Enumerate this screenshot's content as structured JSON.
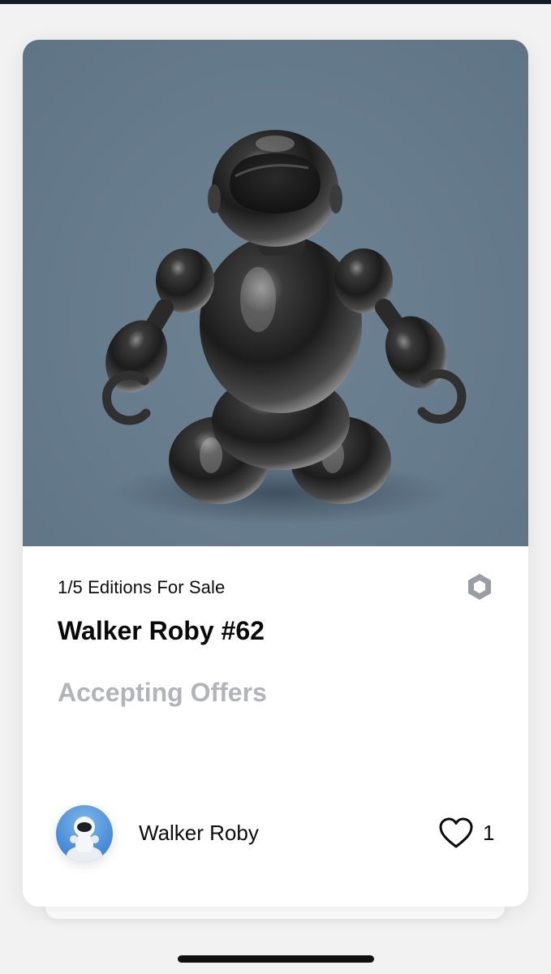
{
  "card": {
    "artwork_alt": "Chrome robot figure",
    "editions_label": "1/5 Editions For Sale",
    "title": "Walker Roby #62",
    "status": "Accepting Offers",
    "creator": {
      "name": "Walker Roby",
      "avatar_icon": "robot-avatar"
    },
    "likes": {
      "icon": "heart-icon",
      "count": "1"
    },
    "badge_icon": "hexagon-icon"
  },
  "colors": {
    "artwork_background": "#667b8c",
    "status_text": "#b3b4b8",
    "avatar_background": "#4d8fd8"
  }
}
